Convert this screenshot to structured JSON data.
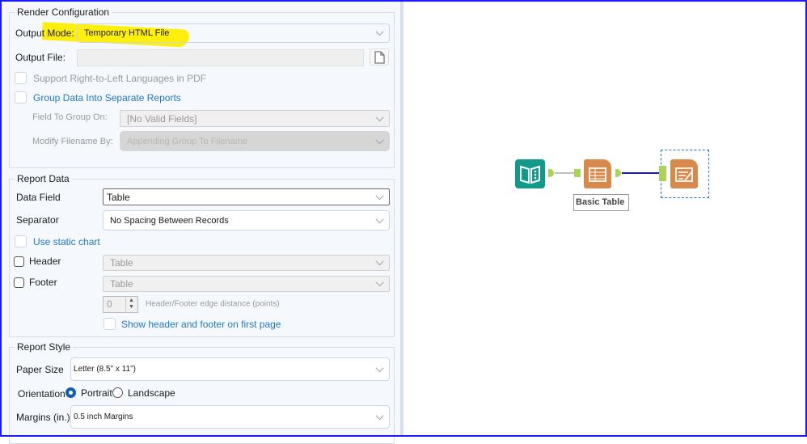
{
  "render_config": {
    "title": "Render Configuration",
    "output_mode_label": "Output Mode:",
    "output_mode_value": "Temporary HTML File",
    "output_file_label": "Output File:",
    "output_file_value": "",
    "rtl_label": "Support Right-to-Left Languages in PDF",
    "group_label": "Group Data Into Separate Reports",
    "field_group_label": "Field To Group On:",
    "field_group_value": "[No Valid Fields]",
    "modify_label": "Modify Filename By:",
    "modify_value": "Appending Group To Filename"
  },
  "report_data": {
    "title": "Report Data",
    "data_field_label": "Data Field",
    "data_field_value": "Table",
    "separator_label": "Separator",
    "separator_value": "No Spacing Between Records",
    "static_chart_label": "Use static chart",
    "header_label": "Header",
    "header_value": "Table",
    "footer_label": "Footer",
    "footer_value": "Table",
    "edge_value": "0",
    "edge_label": "Header/Footer edge distance (points)",
    "show_first_label": "Show header and footer on first page"
  },
  "report_style": {
    "title": "Report Style",
    "paper_label": "Paper Size",
    "paper_value": "Letter (8.5\" x 11\")",
    "orientation_label": "Orientation",
    "portrait_label": "Portrait",
    "landscape_label": "Landscape",
    "margins_label": "Margins (in.)",
    "margins_value": "0.5 inch Margins"
  },
  "workflow": {
    "tool_label": "Basic Table"
  },
  "colors": {
    "highlight": "#ffee00",
    "link": "#1f78c8",
    "teal": "#119a8a",
    "orange": "#d9894a",
    "anchor": "#a9d45a",
    "connection": "#1a1acc"
  }
}
